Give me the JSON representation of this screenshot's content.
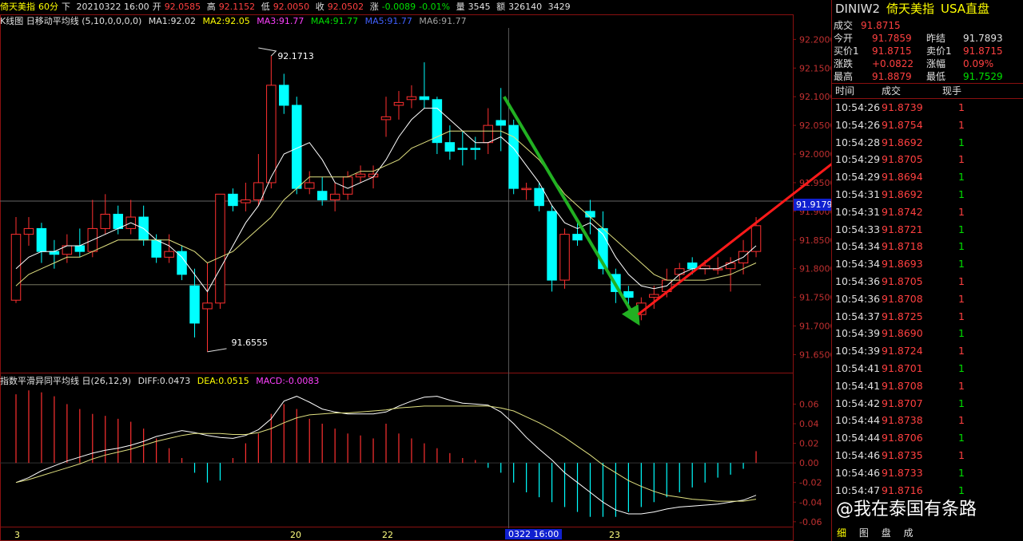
{
  "header": {
    "instrument": "倚天美指",
    "period": "60分",
    "direction": "下",
    "datetime": "20210322 16:00",
    "open_label": "开",
    "open": "92.0585",
    "high_label": "高",
    "high": "92.1152",
    "low_label": "低",
    "low": "92.0050",
    "close_label": "收",
    "close": "92.0502",
    "change_label": "涨",
    "change": "-0.0089",
    "change_pct": "-0.01%",
    "volume_label": "量",
    "volume": "3545",
    "amount_label": "额",
    "amount": "326140",
    "hold": "3429"
  },
  "ma_legend": {
    "title": "K线图 日移动平均线 (5,10,0,0,0,0)",
    "ma1": "MA1:92.02",
    "ma2": "MA2:92.05",
    "ma3": "MA3:91.77",
    "ma4": "MA4:91.77",
    "ma5": "MA5:91.77",
    "ma6": "MA6:91.77"
  },
  "macd_legend": {
    "title": "指数平滑异同平均线 日(26,12,9)",
    "diff": "DIFF:0.0473",
    "dea": "DEA:0.0515",
    "macd": "MACD:-0.0083"
  },
  "annotations": {
    "high_mark": "92.1713",
    "low_mark": "91.6555",
    "current_price": "91.9179"
  },
  "colors": {
    "up": "#ff3030",
    "down": "#00ffff",
    "ma_fast": "#ffffff",
    "ma_slow": "#e0e080",
    "grid": "#8a1010",
    "arrow_green": "#22b022",
    "arrow_red": "#ff1a1a"
  },
  "chart_data": [
    {
      "type": "candlestick",
      "ylim": [
        91.62,
        92.22
      ],
      "yticks": [
        "92.2000",
        "92.1500",
        "92.1000",
        "92.0500",
        "92.0000",
        "91.9500",
        "91.9000",
        "91.8500",
        "91.8000",
        "91.7500",
        "91.7000",
        "91.6500"
      ],
      "x_tick_labels": [
        "3",
        "20",
        "22",
        "0322 16:00",
        "23"
      ],
      "candles": [
        {
          "o": 91.745,
          "c": 91.86,
          "h": 91.89,
          "l": 91.74
        },
        {
          "o": 91.86,
          "c": 91.87,
          "h": 91.89,
          "l": 91.84
        },
        {
          "o": 91.87,
          "c": 91.83,
          "h": 91.88,
          "l": 91.81
        },
        {
          "o": 91.83,
          "c": 91.825,
          "h": 91.85,
          "l": 91.8
        },
        {
          "o": 91.825,
          "c": 91.84,
          "h": 91.86,
          "l": 91.81
        },
        {
          "o": 91.84,
          "c": 91.83,
          "h": 91.87,
          "l": 91.82
        },
        {
          "o": 91.83,
          "c": 91.87,
          "h": 91.92,
          "l": 91.82
        },
        {
          "o": 91.87,
          "c": 91.895,
          "h": 91.93,
          "l": 91.86
        },
        {
          "o": 91.895,
          "c": 91.87,
          "h": 91.91,
          "l": 91.86
        },
        {
          "o": 91.87,
          "c": 91.89,
          "h": 91.92,
          "l": 91.86
        },
        {
          "o": 91.89,
          "c": 91.85,
          "h": 91.91,
          "l": 91.84
        },
        {
          "o": 91.85,
          "c": 91.82,
          "h": 91.86,
          "l": 91.81
        },
        {
          "o": 91.82,
          "c": 91.83,
          "h": 91.86,
          "l": 91.81
        },
        {
          "o": 91.83,
          "c": 91.79,
          "h": 91.84,
          "l": 91.78
        },
        {
          "o": 91.77,
          "c": 91.705,
          "h": 91.8,
          "l": 91.68
        },
        {
          "o": 91.73,
          "c": 91.74,
          "h": 91.81,
          "l": 91.655
        },
        {
          "o": 91.74,
          "c": 91.93,
          "h": 91.93,
          "l": 91.73
        },
        {
          "o": 91.93,
          "c": 91.91,
          "h": 91.94,
          "l": 91.9
        },
        {
          "o": 91.915,
          "c": 91.92,
          "h": 91.95,
          "l": 91.9
        },
        {
          "o": 91.92,
          "c": 91.95,
          "h": 92.0,
          "l": 91.91
        },
        {
          "o": 91.95,
          "c": 92.12,
          "h": 92.1713,
          "l": 91.94
        },
        {
          "o": 92.12,
          "c": 92.085,
          "h": 92.14,
          "l": 92.07
        },
        {
          "o": 92.085,
          "c": 91.94,
          "h": 92.1,
          "l": 91.93
        },
        {
          "o": 91.94,
          "c": 91.95,
          "h": 91.97,
          "l": 91.93
        },
        {
          "o": 91.935,
          "c": 91.92,
          "h": 91.96,
          "l": 91.91
        },
        {
          "o": 91.92,
          "c": 91.93,
          "h": 91.95,
          "l": 91.9
        },
        {
          "o": 91.93,
          "c": 91.96,
          "h": 91.97,
          "l": 91.92
        },
        {
          "o": 91.96,
          "c": 91.965,
          "h": 91.98,
          "l": 91.95
        },
        {
          "o": 91.96,
          "c": 91.965,
          "h": 91.98,
          "l": 91.94
        },
        {
          "o": 92.06,
          "c": 92.065,
          "h": 92.1,
          "l": 92.03
        },
        {
          "o": 92.085,
          "c": 92.09,
          "h": 92.11,
          "l": 92.06
        },
        {
          "o": 92.095,
          "c": 92.1,
          "h": 92.12,
          "l": 92.08
        },
        {
          "o": 92.1,
          "c": 92.095,
          "h": 92.16,
          "l": 92.08
        },
        {
          "o": 92.095,
          "c": 92.02,
          "h": 92.1,
          "l": 92.0
        },
        {
          "o": 92.02,
          "c": 92.005,
          "h": 92.05,
          "l": 91.99
        },
        {
          "o": 92.01,
          "c": 92.008,
          "h": 92.04,
          "l": 91.98
        },
        {
          "o": 92.01,
          "c": 92.008,
          "h": 92.03,
          "l": 91.99
        },
        {
          "o": 92.02,
          "c": 92.05,
          "h": 92.08,
          "l": 92.0
        },
        {
          "o": 92.0585,
          "c": 92.0502,
          "h": 92.1152,
          "l": 92.005
        },
        {
          "o": 92.05,
          "c": 91.94,
          "h": 92.06,
          "l": 91.93
        },
        {
          "o": 91.94,
          "c": 91.94,
          "h": 91.95,
          "l": 91.92
        },
        {
          "o": 91.94,
          "c": 91.91,
          "h": 91.95,
          "l": 91.9
        },
        {
          "o": 91.9,
          "c": 91.78,
          "h": 91.91,
          "l": 91.76
        },
        {
          "o": 91.78,
          "c": 91.86,
          "h": 91.87,
          "l": 91.765
        },
        {
          "o": 91.86,
          "c": 91.85,
          "h": 91.88,
          "l": 91.84
        },
        {
          "o": 91.9,
          "c": 91.89,
          "h": 91.92,
          "l": 91.86
        },
        {
          "o": 91.87,
          "c": 91.8,
          "h": 91.9,
          "l": 91.79
        },
        {
          "o": 91.79,
          "c": 91.76,
          "h": 91.8,
          "l": 91.74
        },
        {
          "o": 91.76,
          "c": 91.75,
          "h": 91.77,
          "l": 91.73
        },
        {
          "o": 91.72,
          "c": 91.74,
          "h": 91.75,
          "l": 91.71
        },
        {
          "o": 91.75,
          "c": 91.755,
          "h": 91.77,
          "l": 91.73
        },
        {
          "o": 91.76,
          "c": 91.78,
          "h": 91.8,
          "l": 91.75
        },
        {
          "o": 91.79,
          "c": 91.8,
          "h": 91.81,
          "l": 91.78
        },
        {
          "o": 91.81,
          "c": 91.8,
          "h": 91.82,
          "l": 91.79
        },
        {
          "o": 91.8,
          "c": 91.805,
          "h": 91.815,
          "l": 91.79
        },
        {
          "o": 91.8,
          "c": 91.8,
          "h": 91.82,
          "l": 91.79
        },
        {
          "o": 91.8,
          "c": 91.81,
          "h": 91.82,
          "l": 91.76
        },
        {
          "o": 91.81,
          "c": 91.83,
          "h": 91.85,
          "l": 91.79
        },
        {
          "o": 91.83,
          "c": 91.875,
          "h": 91.89,
          "l": 91.82
        }
      ],
      "ma_fast": [
        91.8,
        91.82,
        91.83,
        91.83,
        91.84,
        91.84,
        91.85,
        91.86,
        91.87,
        91.88,
        91.87,
        91.85,
        91.84,
        91.82,
        91.79,
        91.76,
        91.8,
        91.84,
        91.88,
        91.91,
        91.96,
        92.0,
        92.01,
        92.02,
        91.99,
        91.95,
        91.94,
        91.95,
        91.96,
        91.99,
        92.03,
        92.06,
        92.08,
        92.08,
        92.06,
        92.04,
        92.02,
        92.02,
        92.03,
        92.01,
        91.98,
        91.95,
        91.91,
        91.88,
        91.87,
        91.88,
        91.86,
        91.82,
        91.79,
        91.77,
        91.765,
        91.77,
        91.79,
        91.8,
        91.8,
        91.8,
        91.81,
        91.82,
        91.84
      ],
      "ma_slow": [
        91.77,
        91.79,
        91.8,
        91.81,
        91.82,
        91.82,
        91.83,
        91.84,
        91.85,
        91.85,
        91.85,
        91.85,
        91.85,
        91.84,
        91.83,
        91.81,
        91.82,
        91.83,
        91.85,
        91.87,
        91.89,
        91.92,
        91.94,
        91.96,
        91.96,
        91.96,
        91.96,
        91.97,
        91.97,
        91.98,
        91.99,
        92.01,
        92.02,
        92.03,
        92.04,
        92.04,
        92.04,
        92.04,
        92.04,
        92.03,
        92.01,
        91.99,
        91.96,
        91.93,
        91.91,
        91.89,
        91.87,
        91.85,
        91.83,
        91.81,
        91.79,
        91.78,
        91.78,
        91.78,
        91.78,
        91.785,
        91.79,
        91.8,
        91.81
      ]
    },
    {
      "type": "macd",
      "ylim": [
        -0.065,
        0.075
      ],
      "yticks": [
        "0.06",
        "0.04",
        "0.02",
        "0.00",
        "-0.02",
        "-0.04",
        "-0.06"
      ],
      "hist": [
        0.07,
        0.074,
        0.072,
        0.068,
        0.06,
        0.055,
        0.05,
        0.048,
        0.045,
        0.042,
        0.035,
        0.025,
        0.015,
        0.005,
        -0.01,
        -0.02,
        -0.018,
        0.005,
        0.02,
        0.03,
        0.05,
        0.06,
        0.055,
        0.045,
        0.04,
        0.035,
        0.03,
        0.028,
        0.025,
        0.04,
        0.03,
        0.025,
        0.02,
        0.015,
        0.01,
        0.005,
        0.003,
        -0.005,
        -0.01,
        -0.02,
        -0.03,
        -0.035,
        -0.04,
        -0.045,
        -0.05,
        -0.055,
        -0.055,
        -0.055,
        -0.05,
        -0.045,
        -0.04,
        -0.035,
        -0.03,
        -0.025,
        -0.02,
        -0.015,
        -0.012,
        -0.006,
        0.012
      ],
      "diff": [
        -0.02,
        -0.015,
        -0.008,
        -0.003,
        0.002,
        0.006,
        0.01,
        0.013,
        0.015,
        0.018,
        0.022,
        0.027,
        0.03,
        0.033,
        0.031,
        0.028,
        0.026,
        0.025,
        0.028,
        0.034,
        0.045,
        0.063,
        0.068,
        0.062,
        0.055,
        0.052,
        0.05,
        0.05,
        0.05,
        0.052,
        0.058,
        0.063,
        0.067,
        0.068,
        0.064,
        0.061,
        0.06,
        0.059,
        0.052,
        0.04,
        0.026,
        0.014,
        0.003,
        -0.01,
        -0.02,
        -0.03,
        -0.04,
        -0.048,
        -0.052,
        -0.052,
        -0.05,
        -0.047,
        -0.045,
        -0.044,
        -0.043,
        -0.042,
        -0.04,
        -0.038,
        -0.033
      ],
      "dea": [
        -0.02,
        -0.017,
        -0.013,
        -0.009,
        -0.005,
        -0.001,
        0.004,
        0.008,
        0.011,
        0.014,
        0.018,
        0.022,
        0.025,
        0.028,
        0.03,
        0.03,
        0.03,
        0.029,
        0.029,
        0.031,
        0.035,
        0.041,
        0.046,
        0.049,
        0.05,
        0.051,
        0.051,
        0.052,
        0.053,
        0.054,
        0.056,
        0.057,
        0.058,
        0.058,
        0.058,
        0.058,
        0.058,
        0.058,
        0.056,
        0.053,
        0.047,
        0.041,
        0.034,
        0.026,
        0.017,
        0.008,
        -0.002,
        -0.01,
        -0.018,
        -0.024,
        -0.029,
        -0.033,
        -0.035,
        -0.037,
        -0.038,
        -0.039,
        -0.039,
        -0.039,
        -0.037
      ]
    }
  ],
  "quote_panel": {
    "code": "DINIW2",
    "name": "倚天美指",
    "feed": "USA直盘",
    "last_label": "成交",
    "last": "91.8715",
    "open_label": "今开",
    "open": "91.7859",
    "prev_label": "昨结",
    "prev": "91.7893",
    "bid_label": "买价1",
    "bid": "91.8715",
    "ask_label": "卖价1",
    "ask": "91.8715",
    "chg_label": "涨跌",
    "chg": "+0.0822",
    "chgpct_label": "涨幅",
    "chgpct": "0.09%",
    "high_label": "最高",
    "high": "91.8879",
    "low_label": "最低",
    "low": "91.7529"
  },
  "tick_table": {
    "headers": [
      "时间",
      "成交",
      "现手"
    ],
    "rows": [
      {
        "time": "10:54:26",
        "price": "91.8739",
        "vol": "1",
        "dir": "up"
      },
      {
        "time": "10:54:26",
        "price": "91.8754",
        "vol": "1",
        "dir": "up"
      },
      {
        "time": "10:54:28",
        "price": "91.8692",
        "vol": "1",
        "dir": "down"
      },
      {
        "time": "10:54:29",
        "price": "91.8705",
        "vol": "1",
        "dir": "up"
      },
      {
        "time": "10:54:29",
        "price": "91.8694",
        "vol": "1",
        "dir": "down"
      },
      {
        "time": "10:54:31",
        "price": "91.8692",
        "vol": "1",
        "dir": "down"
      },
      {
        "time": "10:54:31",
        "price": "91.8742",
        "vol": "1",
        "dir": "up"
      },
      {
        "time": "10:54:33",
        "price": "91.8721",
        "vol": "1",
        "dir": "down"
      },
      {
        "time": "10:54:34",
        "price": "91.8718",
        "vol": "1",
        "dir": "down"
      },
      {
        "time": "10:54:34",
        "price": "91.8693",
        "vol": "1",
        "dir": "down"
      },
      {
        "time": "10:54:36",
        "price": "91.8705",
        "vol": "1",
        "dir": "up"
      },
      {
        "time": "10:54:36",
        "price": "91.8708",
        "vol": "1",
        "dir": "up"
      },
      {
        "time": "10:54:37",
        "price": "91.8725",
        "vol": "1",
        "dir": "up"
      },
      {
        "time": "10:54:39",
        "price": "91.8690",
        "vol": "1",
        "dir": "down"
      },
      {
        "time": "10:54:39",
        "price": "91.8724",
        "vol": "1",
        "dir": "up"
      },
      {
        "time": "10:54:41",
        "price": "91.8701",
        "vol": "1",
        "dir": "down"
      },
      {
        "time": "10:54:41",
        "price": "91.8708",
        "vol": "1",
        "dir": "up"
      },
      {
        "time": "10:54:42",
        "price": "91.8707",
        "vol": "1",
        "dir": "down"
      },
      {
        "time": "10:54:44",
        "price": "91.8738",
        "vol": "1",
        "dir": "up"
      },
      {
        "time": "10:54:44",
        "price": "91.8706",
        "vol": "1",
        "dir": "down"
      },
      {
        "time": "10:54:46",
        "price": "91.8735",
        "vol": "1",
        "dir": "up"
      },
      {
        "time": "10:54:46",
        "price": "91.8733",
        "vol": "1",
        "dir": "down"
      },
      {
        "time": "10:54:47",
        "price": "91.8716",
        "vol": "1",
        "dir": "down"
      }
    ]
  },
  "bottom_tabs": [
    "细",
    "图",
    "盘",
    "成"
  ],
  "watermark": "@我在泰国有条路"
}
